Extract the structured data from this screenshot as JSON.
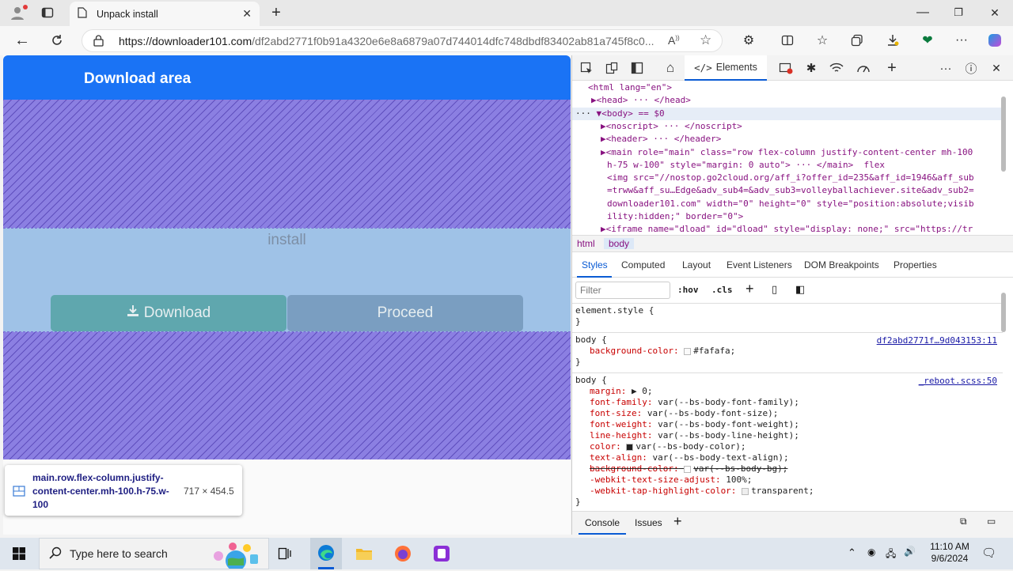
{
  "browser": {
    "tab_title": "Unpack install",
    "url_domain": "https://downloader101.com",
    "url_rest": "/df2abd2771f0b91a4320e6e8a6879a07d744014dfc748dbdf83402ab81a745f8c0...",
    "icons": [
      "profile-icon",
      "tab-actions-icon",
      "page-icon",
      "close-icon",
      "plus-icon",
      "back-icon",
      "refresh-icon",
      "lock-icon",
      "read-aloud-icon",
      "favorite-icon",
      "extensions-icon",
      "split-screen-icon",
      "favorites-icon",
      "collections-icon",
      "downloads-icon",
      "performance-icon",
      "more-icon",
      "copilot-icon"
    ]
  },
  "window": {
    "minimize": "—",
    "maximize": "❐",
    "close": "✕"
  },
  "page": {
    "header_title": "Download area",
    "install_label": "install",
    "download_label": "Download",
    "proceed_label": "Proceed",
    "tooltip_selector": "main.row.flex-column.justify-content-center.mh-100.h-75.w-100",
    "tooltip_size": "717 × 454.5",
    "colors": {
      "header": "#1a73f5",
      "overlay": "#8b7fe2",
      "download": "#5fa7ae",
      "proceed": "#7a9ec1"
    }
  },
  "devtools": {
    "elements_tab": "Elements",
    "dom_lines": [
      "<html lang=\"en\">",
      "▶<head> ··· </head>",
      "▼<body> == $0",
      "▶<noscript> ··· </noscript>",
      "▶<header> ··· </header>",
      "▶<main role=\"main\" class=\"row flex-column justify-content-center mh-100",
      "h-75 w-100\" style=\"margin: 0 auto\"> ··· </main>  flex",
      "<img src=\"//nostop.go2cloud.org/aff_i?offer_id=235&aff_id=1946&aff_sub",
      "=trww&aff_su…Edge&adv_sub4=&adv_sub3=volleyballachiever.site&adv_sub2=",
      "downloader101.com\" width=\"0\" height=\"0\" style=\"position:absolute;visib",
      "ility:hidden;\" border=\"0\">",
      "▶<iframe name=\"dload\" id=\"dload\" style=\"display: none;\" src=\"https://tr"
    ],
    "crumbs": [
      "html",
      "body"
    ],
    "style_tabs": [
      "Styles",
      "Computed",
      "Layout",
      "Event Listeners",
      "DOM Breakpoints",
      "Properties"
    ],
    "filter_placeholder": "Filter",
    "hov": ":hov",
    "cls": ".cls",
    "element_style": "element.style {",
    "rule_close": "}",
    "rule1_selector": "body {",
    "rule1_link": "df2abd2771f…9d043153:11",
    "rule1_prop": "background-color:",
    "rule1_val": "#fafafa;",
    "rule2_selector": "body {",
    "rule2_link": "_reboot.scss:50",
    "rule2_props": [
      [
        "margin:",
        "▶ 0;"
      ],
      [
        "font-family:",
        "var(--bs-body-font-family);"
      ],
      [
        "font-size:",
        "var(--bs-body-font-size);"
      ],
      [
        "font-weight:",
        "var(--bs-body-font-weight);"
      ],
      [
        "line-height:",
        "var(--bs-body-line-height);"
      ],
      [
        "color:",
        "var(--bs-body-color);"
      ],
      [
        "text-align:",
        "var(--bs-body-text-align);"
      ],
      [
        "background-color:",
        "var(--bs-body-bg);"
      ],
      [
        "-webkit-text-size-adjust:",
        "100%;"
      ],
      [
        "-webkit-tap-highlight-color:",
        "transparent;"
      ]
    ],
    "drawer": [
      "Console",
      "Issues"
    ]
  },
  "taskbar": {
    "search_placeholder": "Type here to search",
    "time": "11:10 AM",
    "date": "9/6/2024"
  }
}
